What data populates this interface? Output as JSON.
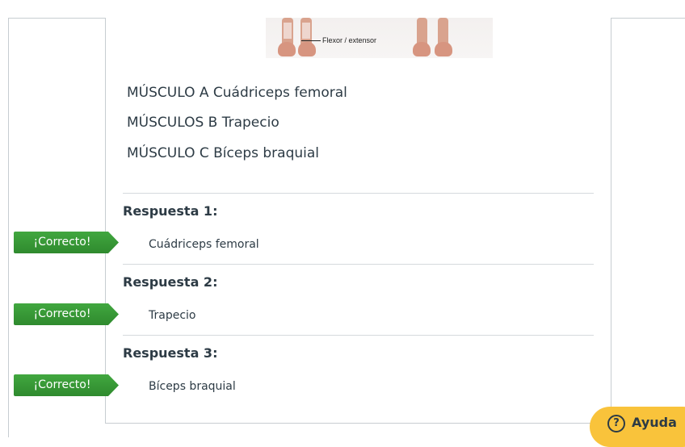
{
  "figure": {
    "label": "Flexor / extensor"
  },
  "muscles": [
    "MÚSCULO A Cuádriceps femoral",
    "MÚSCULOS B Trapecio",
    "MÚSCULO C Bíceps braquial"
  ],
  "answers": [
    {
      "heading": "Respuesta 1:",
      "value": "Cuádriceps femoral",
      "flag": "¡Correcto!"
    },
    {
      "heading": "Respuesta 2:",
      "value": "Trapecio",
      "flag": "¡Correcto!"
    },
    {
      "heading": "Respuesta 3:",
      "value": "Bíceps braquial",
      "flag": "¡Correcto!"
    }
  ],
  "help": {
    "label": "Ayuda",
    "icon": "question-circle-icon"
  }
}
